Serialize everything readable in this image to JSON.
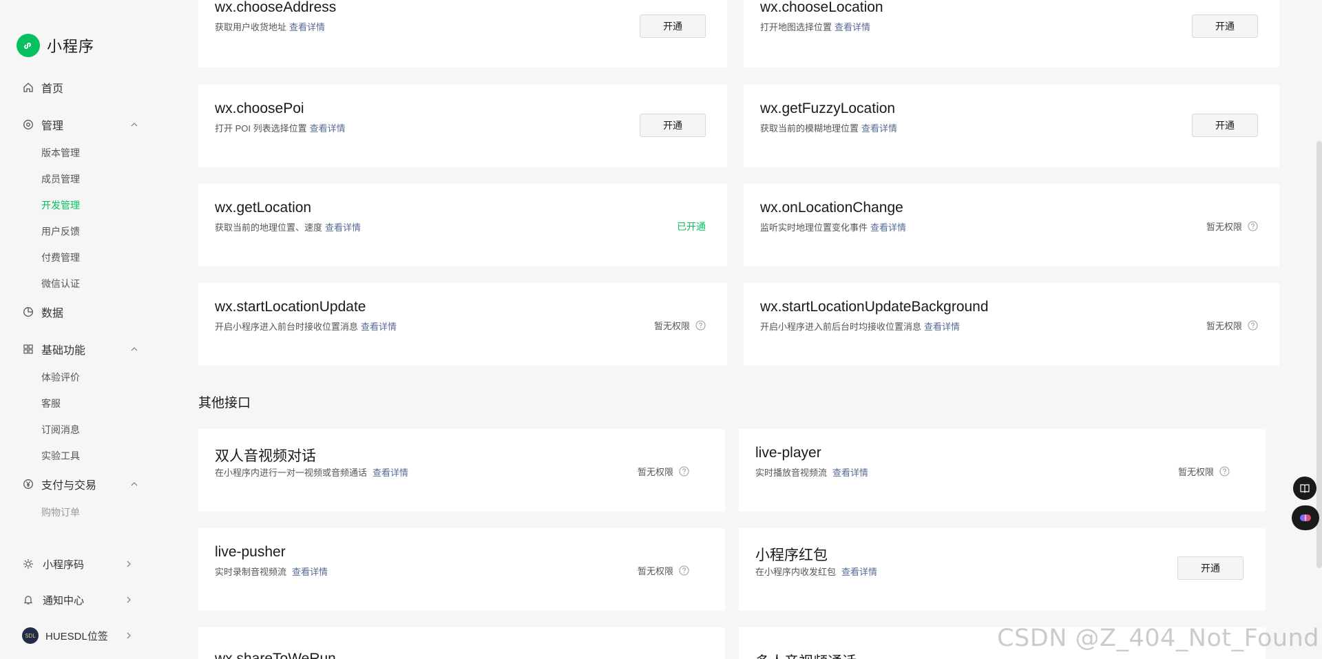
{
  "brand": {
    "name": "小程序",
    "logo_icon": "mini-program-logo-icon",
    "color": "#07c160"
  },
  "sidebar": {
    "home": {
      "label": "首页",
      "icon": "home-icon"
    },
    "manage": {
      "label": "管理",
      "icon": "manage-icon",
      "items": [
        "版本管理",
        "成员管理",
        "开发管理",
        "用户反馈",
        "付费管理",
        "微信认证"
      ],
      "active": "开发管理"
    },
    "data": {
      "label": "数据",
      "icon": "chart-icon"
    },
    "basic": {
      "label": "基础功能",
      "icon": "grid-icon",
      "items": [
        "体验评价",
        "客服",
        "订阅消息",
        "实验工具"
      ]
    },
    "pay": {
      "label": "支付与交易",
      "icon": "yen-icon",
      "items": [
        "购物订单"
      ]
    },
    "bottom": [
      {
        "label": "小程序码",
        "icon": "sun-icon"
      },
      {
        "label": "通知中心",
        "icon": "bell-icon"
      },
      {
        "label": "HUESDL位签",
        "icon": "avatar"
      }
    ],
    "avatar_text": "SDL"
  },
  "link_label": "查看详情",
  "open_label": "开通",
  "opened_label": "已开通",
  "no_permission_label": "暂无权限",
  "location_apis": [
    {
      "title": "wx.chooseAddress",
      "desc": "获取用户收货地址",
      "status": "button"
    },
    {
      "title": "wx.chooseLocation",
      "desc": "打开地图选择位置",
      "status": "button"
    },
    {
      "title": "wx.choosePoi",
      "desc": "打开 POI 列表选择位置",
      "status": "button"
    },
    {
      "title": "wx.getFuzzyLocation",
      "desc": "获取当前的模糊地理位置",
      "status": "button"
    },
    {
      "title": "wx.getLocation",
      "desc": "获取当前的地理位置、速度",
      "status": "opened"
    },
    {
      "title": "wx.onLocationChange",
      "desc": "监听实时地理位置变化事件",
      "status": "none"
    },
    {
      "title": "wx.startLocationUpdate",
      "desc": "开启小程序进入前台时接收位置消息",
      "status": "none"
    },
    {
      "title": "wx.startLocationUpdateBackground",
      "desc": "开启小程序进入前后台时均接收位置消息",
      "status": "none"
    }
  ],
  "other_section_title": "其他接口",
  "other_apis": [
    {
      "title": "双人音视频对话",
      "desc": "在小程序内进行一对一视频或音频通话",
      "status": "none"
    },
    {
      "title": "live-player",
      "desc": "实时播放音视频流",
      "status": "none"
    },
    {
      "title": "live-pusher",
      "desc": "实时录制音视频流",
      "status": "none"
    },
    {
      "title": "小程序红包",
      "desc": "在小程序内收发红包",
      "status": "button"
    },
    {
      "title": "wx.shareToWeRun",
      "desc": "",
      "status": "none"
    },
    {
      "title": "多人音视频通话",
      "desc": "",
      "status": "none"
    }
  ],
  "watermark": "CSDN @Z_404_Not_Found",
  "colors": {
    "accent": "#07c160",
    "link": "#576b95"
  }
}
